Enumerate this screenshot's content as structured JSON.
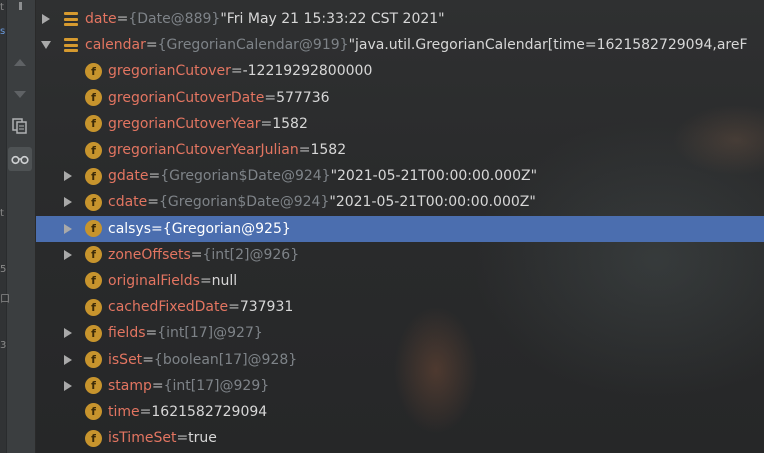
{
  "colors": {
    "field_name": "#e37561",
    "reference": "#7e8388",
    "value": "#d7d7d7",
    "selection": "#4b6eaf",
    "field_icon": "#c7942d"
  },
  "toolbar": {
    "icons": [
      "arrow-up-icon",
      "arrow-down-icon",
      "copy-icon",
      "glasses-icon"
    ],
    "edge_marks": [
      "t",
      "s",
      "t",
      "5",
      "口",
      "3"
    ]
  },
  "tree": {
    "rows": [
      {
        "name": "date",
        "eq": " = ",
        "ref": "{Date@889}",
        "val": " \"Fri May 21 15:33:22 CST 2021\""
      },
      {
        "name": "calendar",
        "eq": " = ",
        "ref": "{GregorianCalendar@919}",
        "val": " \"java.util.GregorianCalendar[time=1621582729094,areF"
      },
      {
        "name": "gregorianCutover",
        "eq": " = ",
        "ref": "",
        "val": "-12219292800000"
      },
      {
        "name": "gregorianCutoverDate",
        "eq": " = ",
        "ref": "",
        "val": "577736"
      },
      {
        "name": "gregorianCutoverYear",
        "eq": " = ",
        "ref": "",
        "val": "1582"
      },
      {
        "name": "gregorianCutoverYearJulian",
        "eq": " = ",
        "ref": "",
        "val": "1582"
      },
      {
        "name": "gdate",
        "eq": " = ",
        "ref": "{Gregorian$Date@924}",
        "val": " \"2021-05-21T00:00:00.000Z\""
      },
      {
        "name": "cdate",
        "eq": " = ",
        "ref": "{Gregorian$Date@924}",
        "val": " \"2021-05-21T00:00:00.000Z\""
      },
      {
        "name": "calsys",
        "eq": " = ",
        "ref": "{Gregorian@925}",
        "val": ""
      },
      {
        "name": "zoneOffsets",
        "eq": " = ",
        "ref": "{int[2]@926}",
        "val": ""
      },
      {
        "name": "originalFields",
        "eq": " = ",
        "ref": "",
        "val": "null"
      },
      {
        "name": "cachedFixedDate",
        "eq": " = ",
        "ref": "",
        "val": "737931"
      },
      {
        "name": "fields",
        "eq": " = ",
        "ref": "{int[17]@927}",
        "val": ""
      },
      {
        "name": "isSet",
        "eq": " = ",
        "ref": "{boolean[17]@928}",
        "val": ""
      },
      {
        "name": "stamp",
        "eq": " = ",
        "ref": "{int[17]@929}",
        "val": ""
      },
      {
        "name": "time",
        "eq": " = ",
        "ref": "",
        "val": "1621582729094"
      },
      {
        "name": "isTimeSet",
        "eq": " = ",
        "ref": "",
        "val": "true"
      }
    ]
  }
}
